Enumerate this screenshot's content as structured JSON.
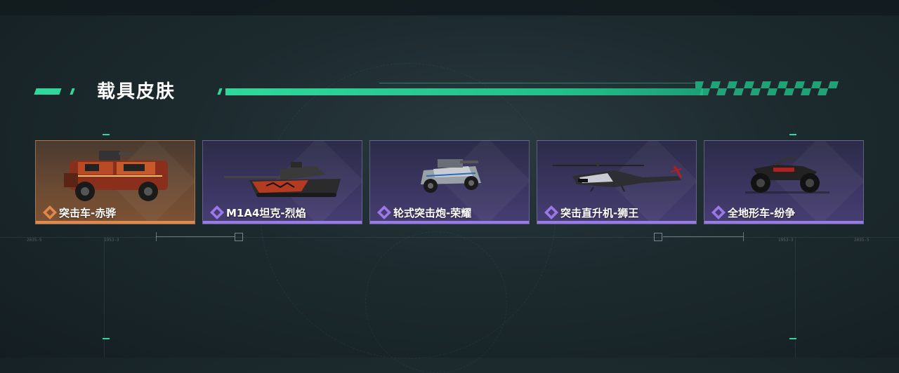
{
  "section": {
    "title": "载具皮肤"
  },
  "skins": [
    {
      "label": "突击车-赤骅",
      "rarity": "orange",
      "vehicle": "armored-truck-icon"
    },
    {
      "label": "M1A4坦克-烈焰",
      "rarity": "purple",
      "vehicle": "tank-icon"
    },
    {
      "label": "轮式突击炮-荣耀",
      "rarity": "purple",
      "vehicle": "assault-buggy-icon"
    },
    {
      "label": "突击直升机-狮王",
      "rarity": "purple",
      "vehicle": "helicopter-icon"
    },
    {
      "label": "全地形车-纷争",
      "rarity": "purple",
      "vehicle": "atv-icon"
    }
  ],
  "guides": {
    "left_a": "2035-5",
    "left_b": "1953-3",
    "right_a": "1953-3",
    "right_b": "2035-5"
  },
  "colors": {
    "accent": "#2fd89a",
    "purple": "#9a78e8",
    "orange": "#e0894a"
  }
}
